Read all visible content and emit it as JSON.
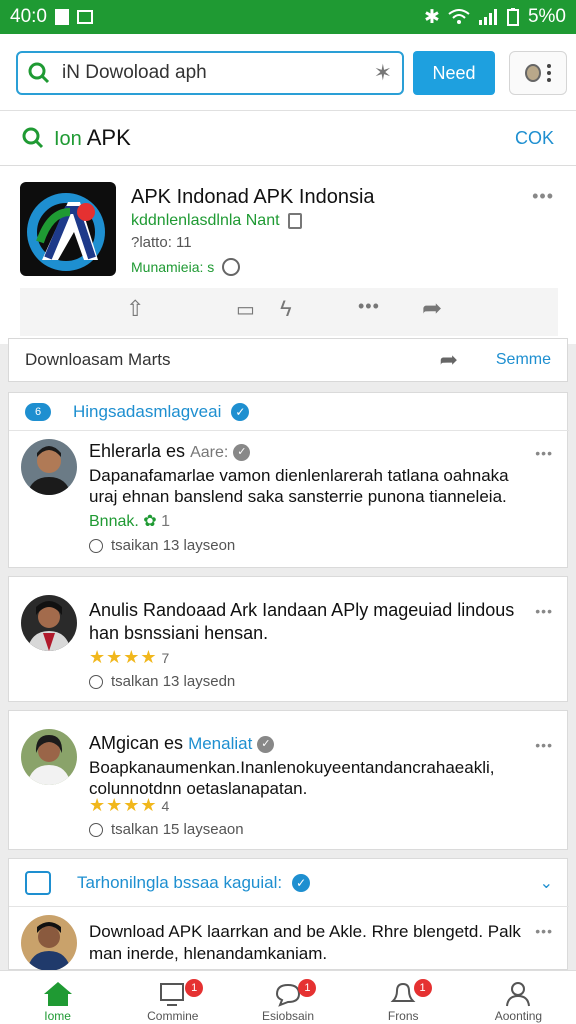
{
  "status_bar": {
    "time": "40:0",
    "battery": "5%0"
  },
  "search": {
    "value": "iN Dowoload aph",
    "button_label": "Need"
  },
  "sub_search": {
    "title_prefix": "Ion",
    "title": "APK",
    "action": "COK"
  },
  "app": {
    "title": "APK Indonad APK Indonsia",
    "developer": "kddnlenlasdlnla Nant",
    "meta": "?latto: 11",
    "category": "Munamieia: s"
  },
  "download_row": {
    "label": "Downloasam Marts",
    "action": "Semme"
  },
  "verified_header": {
    "icon_text": "6",
    "label": "Hingsadasmlagveai"
  },
  "review1": {
    "name": "Ehlerarla es",
    "name_suffix": "Aare:",
    "body": "Dapanafamarlae vamon dienlenlarerah tatlana oahnaka uraj ehnan banslend saka sansterrie punona tianneleia.",
    "tag": "Bnnak.",
    "tag_count": "1",
    "time": "tsaikan 13 layseon"
  },
  "review2": {
    "title": "Anulis Randoaad Ark Iandaan APly mageuiad lindous han bsnssiani hensan.",
    "rating": 4,
    "rating_text": "7",
    "time": "tsalkan 13 laysedn"
  },
  "review3": {
    "name": "AMgican es",
    "name_suffix": "Menaliat",
    "body": "Boapkanaumenkan.Inanlenokuyeentandancrahaeakli, colunnotdnn oetaslanapatan.",
    "rating": 4,
    "rating_text": "4",
    "time": "tsalkan 15 layseaon"
  },
  "section": {
    "label": "Tarhonilngla bssaa kaguial:"
  },
  "review4": {
    "body": "Download APK laarrkan and be Akle. Rhre blengetd. Palk man inerde, hlenandamkaniam."
  },
  "nav": {
    "home": "Iome",
    "comments": "Commine",
    "feedback": "Esiobsain",
    "forum": "Frons",
    "account": "Aoonting"
  },
  "badges": {
    "comments": "1",
    "feedback": "1",
    "forum": "1"
  },
  "colors": {
    "status_green": "#1f9a33",
    "accent_blue": "#1ea0df",
    "star": "#f1b71c",
    "badge_red": "#e53131"
  }
}
